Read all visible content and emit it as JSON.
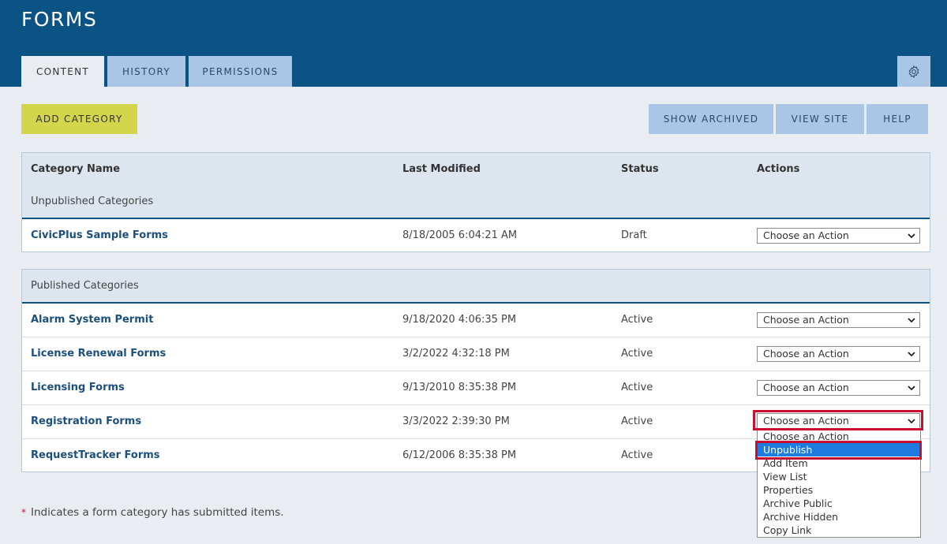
{
  "header": {
    "title": "FORMS"
  },
  "tabs": [
    {
      "label": "CONTENT"
    },
    {
      "label": "HISTORY"
    },
    {
      "label": "PERMISSIONS"
    }
  ],
  "toolbar": {
    "add_category": "ADD CATEGORY",
    "show_archived": "SHOW ARCHIVED",
    "view_site": "VIEW SITE",
    "help": "HELP"
  },
  "columns": {
    "name": "Category Name",
    "last_modified": "Last Modified",
    "status": "Status",
    "actions": "Actions"
  },
  "unpublished": {
    "label": "Unpublished Categories",
    "rows": [
      {
        "name": "CivicPlus Sample Forms",
        "date": "8/18/2005 6:04:21 AM",
        "status": "Draft",
        "action": "Choose an Action"
      }
    ]
  },
  "published": {
    "label": "Published Categories",
    "rows": [
      {
        "name": "Alarm System Permit",
        "date": "9/18/2020 4:06:35 PM",
        "status": "Active",
        "action": "Choose an Action"
      },
      {
        "name": "License Renewal Forms",
        "date": "3/2/2022 4:32:18 PM",
        "status": "Active",
        "action": "Choose an Action"
      },
      {
        "name": "Licensing Forms",
        "date": "9/13/2010 8:35:38 PM",
        "status": "Active",
        "action": "Choose an Action"
      },
      {
        "name": "Registration Forms",
        "date": "3/3/2022 2:39:30 PM",
        "status": "Active",
        "action": "Choose an Action"
      },
      {
        "name": "RequestTracker Forms",
        "date": "6/12/2006 8:35:38 PM",
        "status": "Active",
        "action": "Choose an Action"
      }
    ]
  },
  "dropdown": {
    "options": [
      "Choose an Action",
      "Unpublish",
      "Add Item",
      "View List",
      "Properties",
      "Archive Public",
      "Archive Hidden",
      "Copy Link"
    ],
    "selected": "Unpublish"
  },
  "footnote": {
    "star": "*",
    "text": "Indicates a form category has submitted items."
  },
  "icons": {
    "settings": "gear-icon",
    "select_arrow": "chevron-down-icon"
  },
  "colors": {
    "header": "#0b5384",
    "tab": "#a9c6e6",
    "add_button": "#d3d64a",
    "highlight": "#c8102e",
    "selected_option": "#1e7be0"
  }
}
